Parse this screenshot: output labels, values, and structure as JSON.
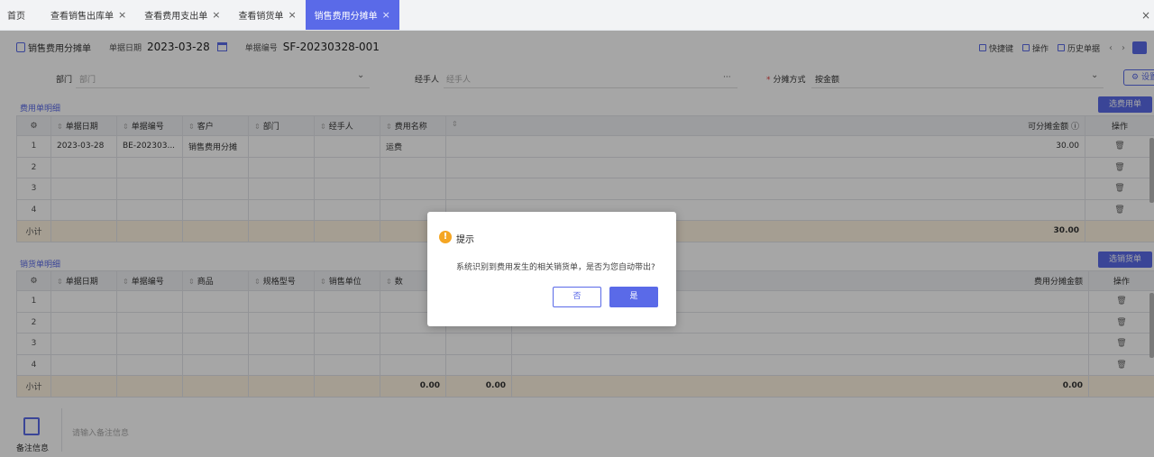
{
  "tabs": [
    {
      "label": "首页",
      "closable": false,
      "active": false
    },
    {
      "label": "查看销售出库单",
      "closable": true,
      "active": false
    },
    {
      "label": "查看费用支出单",
      "closable": true,
      "active": false
    },
    {
      "label": "查看销货单",
      "closable": true,
      "active": false
    },
    {
      "label": "销售费用分摊单",
      "closable": true,
      "active": true
    }
  ],
  "close_glyph": "×",
  "header": {
    "doc_title": "销售费用分摊单",
    "date_label": "单据日期",
    "date_value": "2023-03-28",
    "number_label": "单据编号",
    "number_value": "SF-20230328-001",
    "tools": [
      "快捷键",
      "操作",
      "历史单据"
    ],
    "prev": "‹",
    "next": "›"
  },
  "form": {
    "dept_label": "部门",
    "dept_placeholder": "部门",
    "handler_label": "经手人",
    "handler_placeholder": "经手人",
    "handler_more": "···",
    "method_label": "分摊方式",
    "method_value": "按金额",
    "settings_label": "设置"
  },
  "expense": {
    "section_title": "费用单明细",
    "select_button": "选费用单",
    "columns": [
      "单据日期",
      "单据编号",
      "客户",
      "部门",
      "经手人",
      "费用名称",
      "",
      "可分摊金额 ⓘ",
      "操作"
    ],
    "rows": [
      {
        "idx": "1",
        "date": "2023-03-28",
        "number": "BE-202303...",
        "customer": "销售费用分摊",
        "dept": "",
        "handler": "",
        "expense": "运费",
        "blank": "",
        "amount": "30.00"
      },
      {
        "idx": "2",
        "date": "",
        "number": "",
        "customer": "",
        "dept": "",
        "handler": "",
        "expense": "",
        "blank": "",
        "amount": ""
      },
      {
        "idx": "3",
        "date": "",
        "number": "",
        "customer": "",
        "dept": "",
        "handler": "",
        "expense": "",
        "blank": "",
        "amount": ""
      },
      {
        "idx": "4",
        "date": "",
        "number": "",
        "customer": "",
        "dept": "",
        "handler": "",
        "expense": "",
        "blank": "",
        "amount": ""
      }
    ],
    "subtotal_label": "小计",
    "subtotal_amount": "30.00"
  },
  "sales": {
    "section_title": "销货单明细",
    "select_button": "选销货单",
    "columns": [
      "单据日期",
      "单据编号",
      "商品",
      "规格型号",
      "销售单位",
      "数",
      "",
      "费用分摊金额",
      "操作"
    ],
    "rows": [
      {
        "idx": "1"
      },
      {
        "idx": "2"
      },
      {
        "idx": "3"
      },
      {
        "idx": "4"
      }
    ],
    "subtotal_label": "小计",
    "subtotal_qty": "0.00",
    "subtotal_amount2": "0.00",
    "subtotal_alloc": "0.00"
  },
  "notes": {
    "label": "备注信息",
    "placeholder": "请输入备注信息"
  },
  "dialog": {
    "title": "提示",
    "message": "系统识别到费用发生的相关销货单，是否为您自动带出?",
    "no_label": "否",
    "yes_label": "是",
    "icon_glyph": "!"
  },
  "icons": {
    "trash": "🗑",
    "help": "ⓘ",
    "sort": "⇕"
  }
}
